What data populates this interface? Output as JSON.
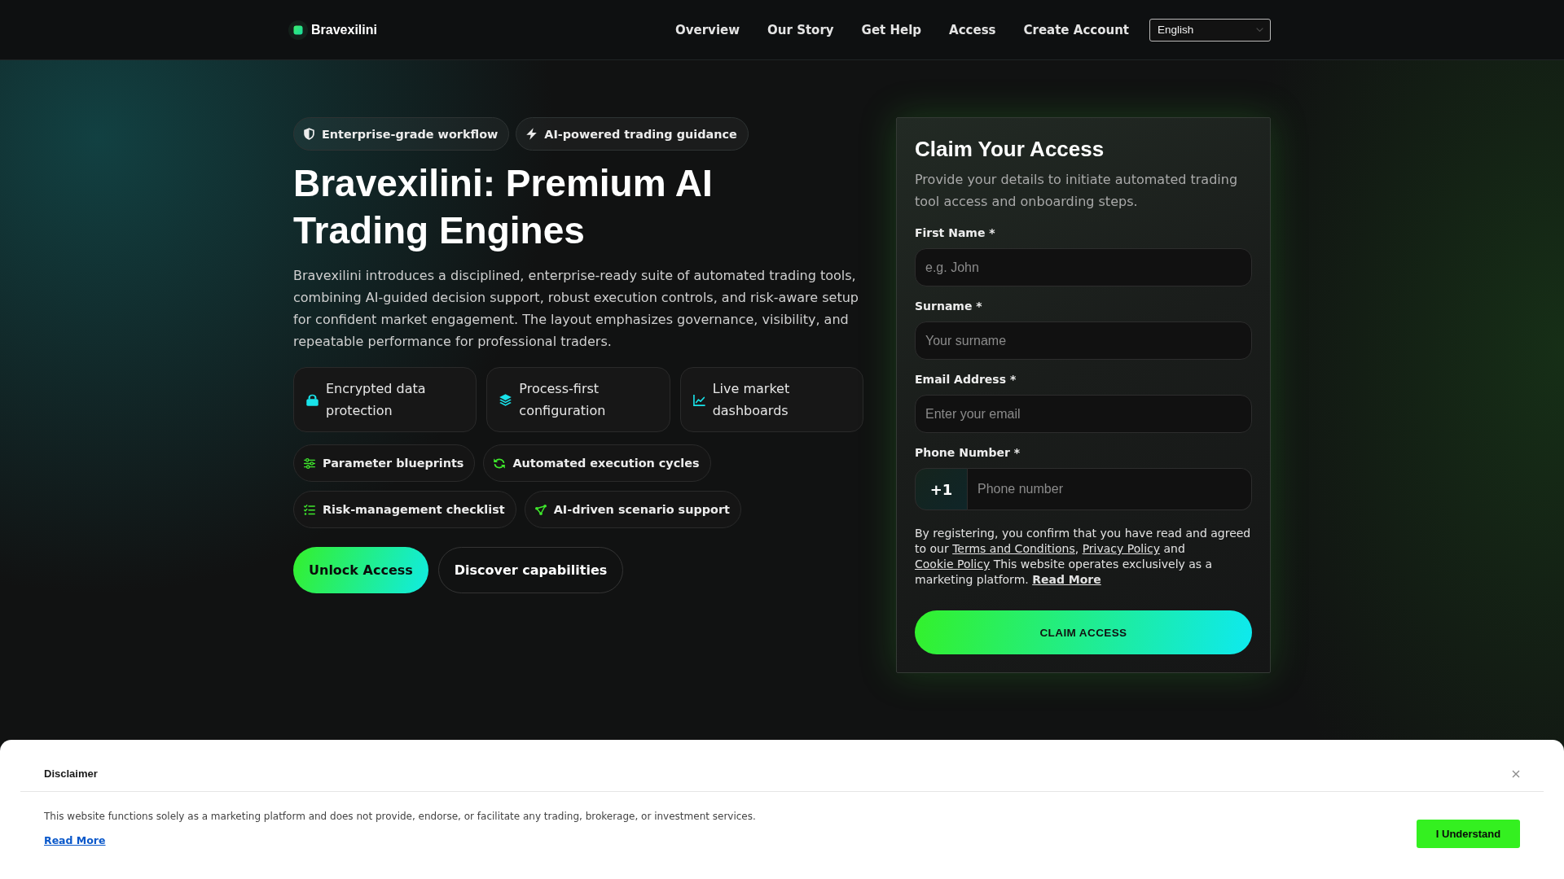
{
  "header": {
    "brand": "Bravexilini",
    "nav": [
      {
        "label": "Overview"
      },
      {
        "label": "Our Story"
      },
      {
        "label": "Get Help"
      },
      {
        "label": "Access"
      },
      {
        "label": "Create Account"
      }
    ],
    "language": "English"
  },
  "hero": {
    "badges": [
      {
        "label": "Enterprise-grade workflow"
      },
      {
        "label": "AI-powered trading guidance"
      }
    ],
    "title": "Bravexilini: Premium AI Trading Engines",
    "description": "Bravexilini introduces a disciplined, enterprise-ready suite of automated trading tools, combining AI-guided decision support, robust execution controls, and risk-aware setup for confident market engagement. The layout emphasizes governance, visibility, and repeatable performance for professional traders.",
    "features": [
      {
        "label": "Encrypted data protection"
      },
      {
        "label": "Process-first configuration"
      },
      {
        "label": "Live market dashboards"
      }
    ],
    "highlights": [
      {
        "label": "Parameter blueprints"
      },
      {
        "label": "Automated execution cycles"
      },
      {
        "label": "Risk-management checklist"
      },
      {
        "label": "AI-driven scenario support"
      }
    ],
    "buttons": [
      {
        "kind": "primary",
        "label": "Unlock Access"
      },
      {
        "kind": "outline",
        "label": "Discover capabilities"
      }
    ]
  },
  "form": {
    "title": "Claim Your Access",
    "description": "Provide your details to initiate automated trading tool access and onboarding steps.",
    "fields": [
      {
        "kind": "text",
        "label": "First Name *",
        "placeholder": "e.g. John"
      },
      {
        "kind": "text",
        "label": "Surname *",
        "placeholder": "Your surname"
      },
      {
        "kind": "email",
        "label": "Email Address *",
        "placeholder": "Enter your email"
      },
      {
        "kind": "phone",
        "label": "Phone Number *",
        "prefix": "+1",
        "placeholder": "Phone number"
      }
    ],
    "consent": [
      {
        "kind": "text",
        "text": "By registering, you confirm that you have read and agreed to our "
      },
      {
        "kind": "link",
        "text": "Terms and Conditions"
      },
      {
        "kind": "text",
        "text": ", "
      },
      {
        "kind": "link",
        "text": "Privacy Policy"
      },
      {
        "kind": "text",
        "text": " and "
      },
      {
        "kind": "link",
        "text": "Cookie Policy"
      },
      {
        "kind": "text",
        "text": " This website operates exclusively as a marketing platform. "
      },
      {
        "kind": "strong-link",
        "text": "Read More"
      }
    ],
    "submit": "CLAIM ACCESS"
  },
  "disclaimer": {
    "title": "Disclaimer",
    "text": "This website functions solely as a marketing platform and does not provide, endorse, or facilitate any trading, brokerage, or investment services.",
    "link": "Read More",
    "button": "I Understand"
  }
}
